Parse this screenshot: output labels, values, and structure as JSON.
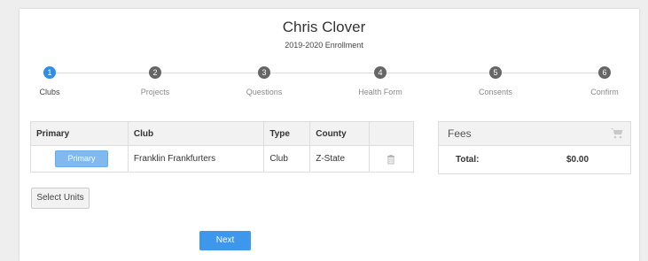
{
  "header": {
    "name": "Chris Clover",
    "subtitle": "2019-2020 Enrollment"
  },
  "steps": [
    {
      "number": "1",
      "label": "Clubs",
      "active": true
    },
    {
      "number": "2",
      "label": "Projects",
      "active": false
    },
    {
      "number": "3",
      "label": "Questions",
      "active": false
    },
    {
      "number": "4",
      "label": "Health Form",
      "active": false
    },
    {
      "number": "5",
      "label": "Consents",
      "active": false
    },
    {
      "number": "6",
      "label": "Confirm",
      "active": false
    }
  ],
  "clubs_table": {
    "headers": [
      "Primary",
      "Club",
      "Type",
      "County",
      ""
    ],
    "rows": [
      {
        "primary_button": "Primary",
        "club": "Franklin Frankfurters",
        "type": "Club",
        "county": "Z-State",
        "action_icon": "trash-icon"
      }
    ]
  },
  "fees": {
    "title": "Fees",
    "icon": "shopping-cart-icon",
    "total_label": "Total:",
    "total_value": "$0.00"
  },
  "buttons": {
    "select_units": "Select Units",
    "next": "Next"
  },
  "colors": {
    "accent": "#3d97ea",
    "active_step": "#2f8fe6",
    "inactive_step": "#666666",
    "primary_button": "#7fb9ee"
  }
}
